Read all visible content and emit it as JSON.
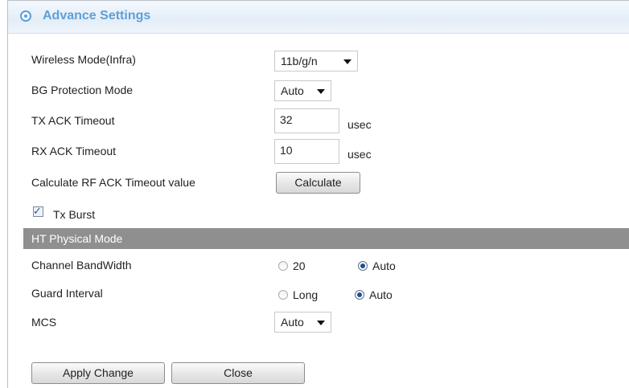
{
  "header": {
    "title": "Advance Settings"
  },
  "settings": {
    "wireless_mode": {
      "label": "Wireless Mode(Infra)",
      "value": "11b/g/n"
    },
    "bg_protection": {
      "label": "BG Protection Mode",
      "value": "Auto"
    },
    "tx_ack": {
      "label": "TX ACK Timeout",
      "value": "32",
      "unit": "usec"
    },
    "rx_ack": {
      "label": "RX ACK Timeout",
      "value": "10",
      "unit": "usec"
    },
    "calculate": {
      "label": "Calculate RF ACK Timeout value",
      "button": "Calculate"
    },
    "tx_burst": {
      "label": "Tx Burst",
      "checked": true
    }
  },
  "ht": {
    "section_title": "HT Physical Mode",
    "channel_bandwidth": {
      "label": "Channel BandWidth",
      "options": [
        "20",
        "Auto"
      ],
      "selected": "Auto"
    },
    "guard_interval": {
      "label": "Guard Interval",
      "options": [
        "Long",
        "Auto"
      ],
      "selected": "Auto"
    },
    "mcs": {
      "label": "MCS",
      "value": "Auto"
    }
  },
  "actions": {
    "apply": "Apply Change",
    "close": "Close"
  },
  "colors": {
    "title": "#5f9fd6",
    "section_bar": "#8f8f8f"
  }
}
